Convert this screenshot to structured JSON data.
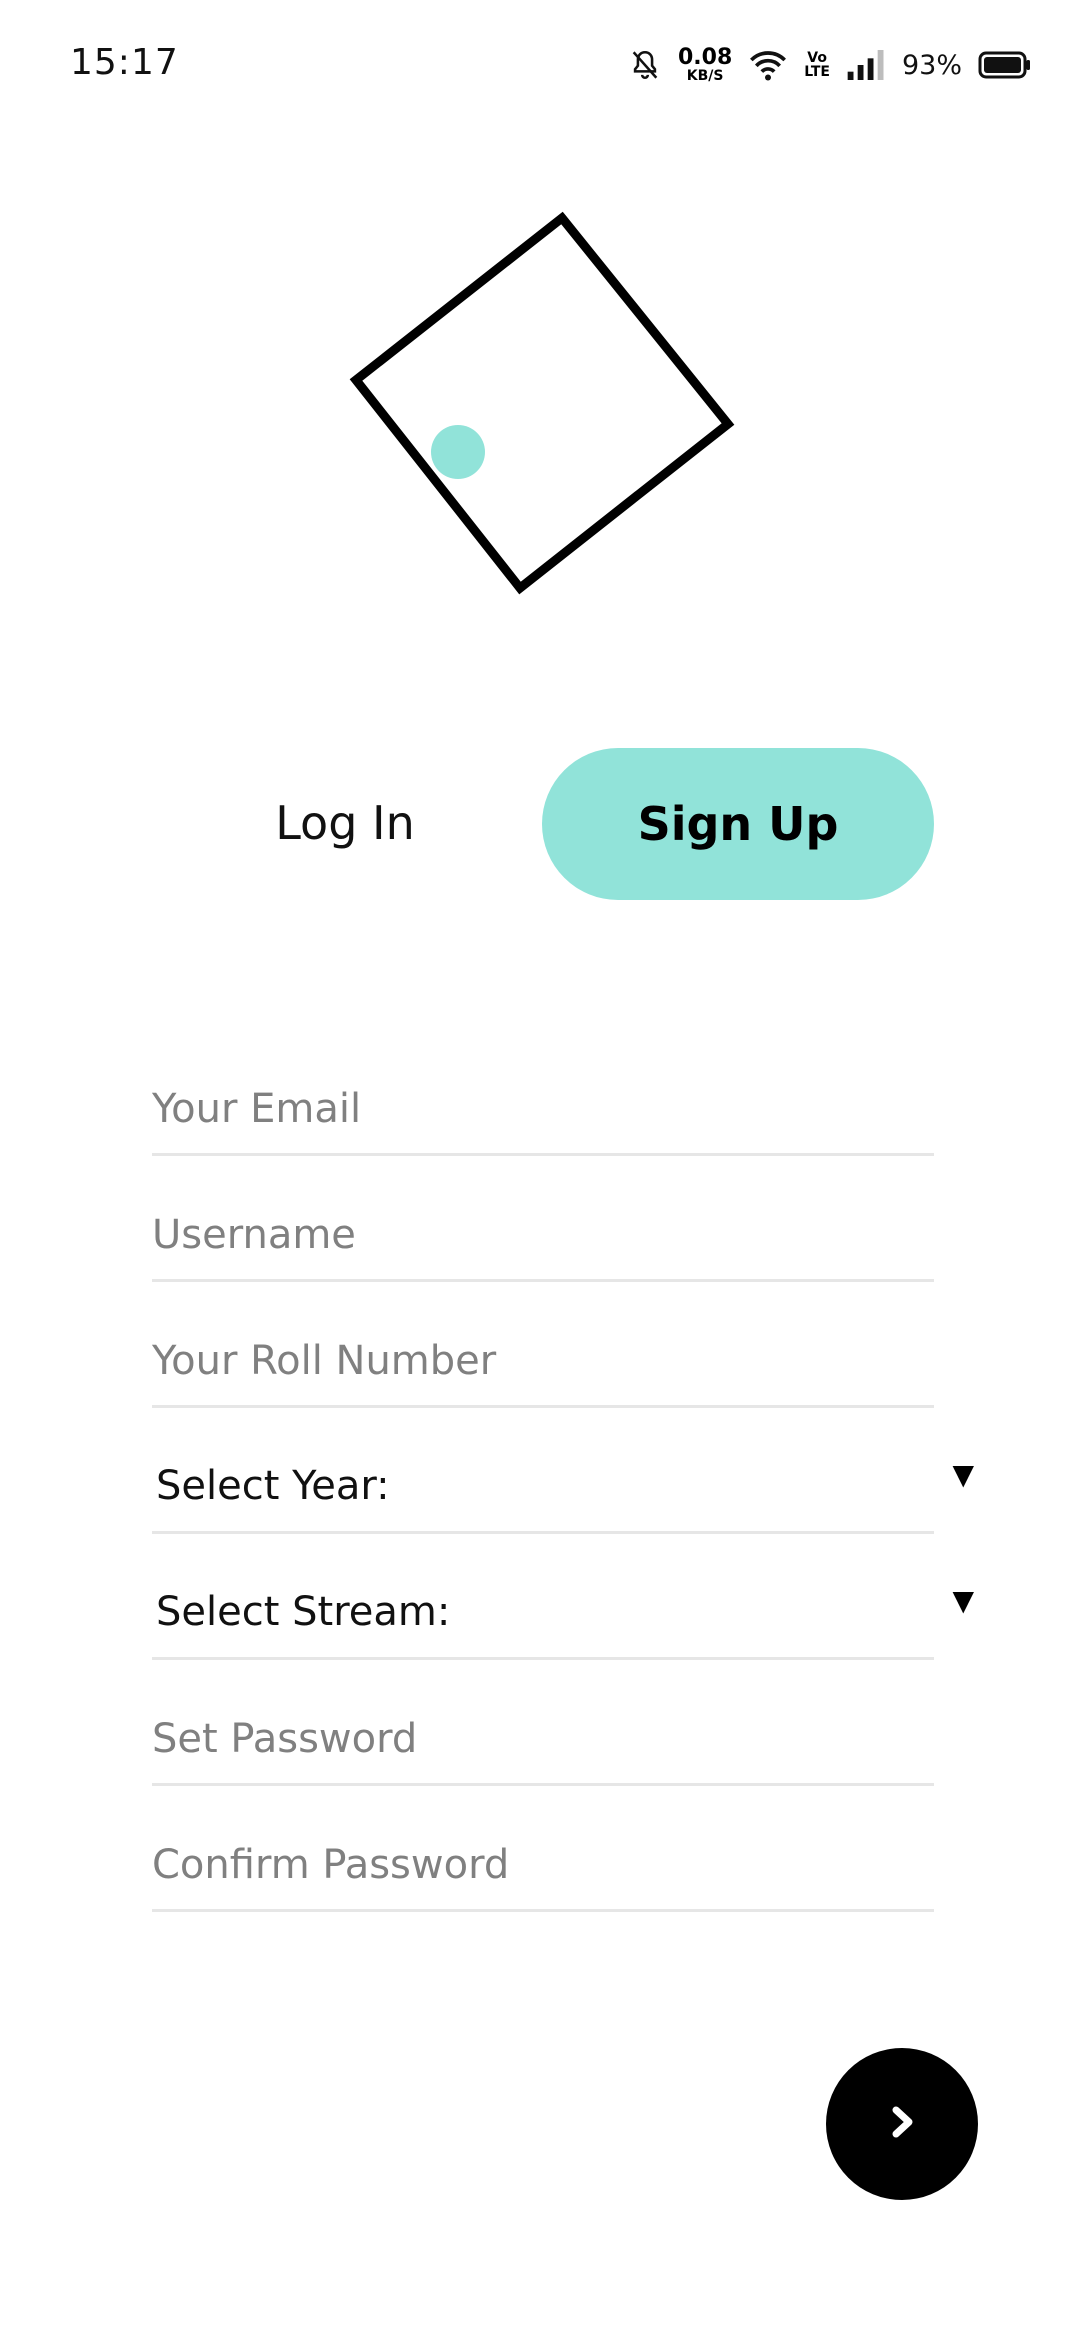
{
  "status_bar": {
    "time": "15:17",
    "net_speed_value": "0.08",
    "net_speed_unit": "KB/S",
    "volte_top": "Vo",
    "volte_bottom": "LTE",
    "battery_percent": "93%",
    "icons": [
      "bell-muted-icon",
      "wifi-icon",
      "signal-icon",
      "battery-icon"
    ]
  },
  "logo": {
    "accent_color": "#91e3d9",
    "stroke_color": "#000000"
  },
  "tabs": {
    "login_label": "Log In",
    "signup_label": "Sign Up",
    "active": "signup"
  },
  "form": {
    "email_placeholder": "Your Email",
    "username_placeholder": "Username",
    "roll_placeholder": "Your Roll Number",
    "year_label": "Select Year:",
    "stream_label": "Select Stream:",
    "caret": "▼",
    "password_placeholder": "Set Password",
    "confirm_password_placeholder": "Confirm Password"
  },
  "actions": {
    "next_icon": "chevron-right-icon"
  }
}
